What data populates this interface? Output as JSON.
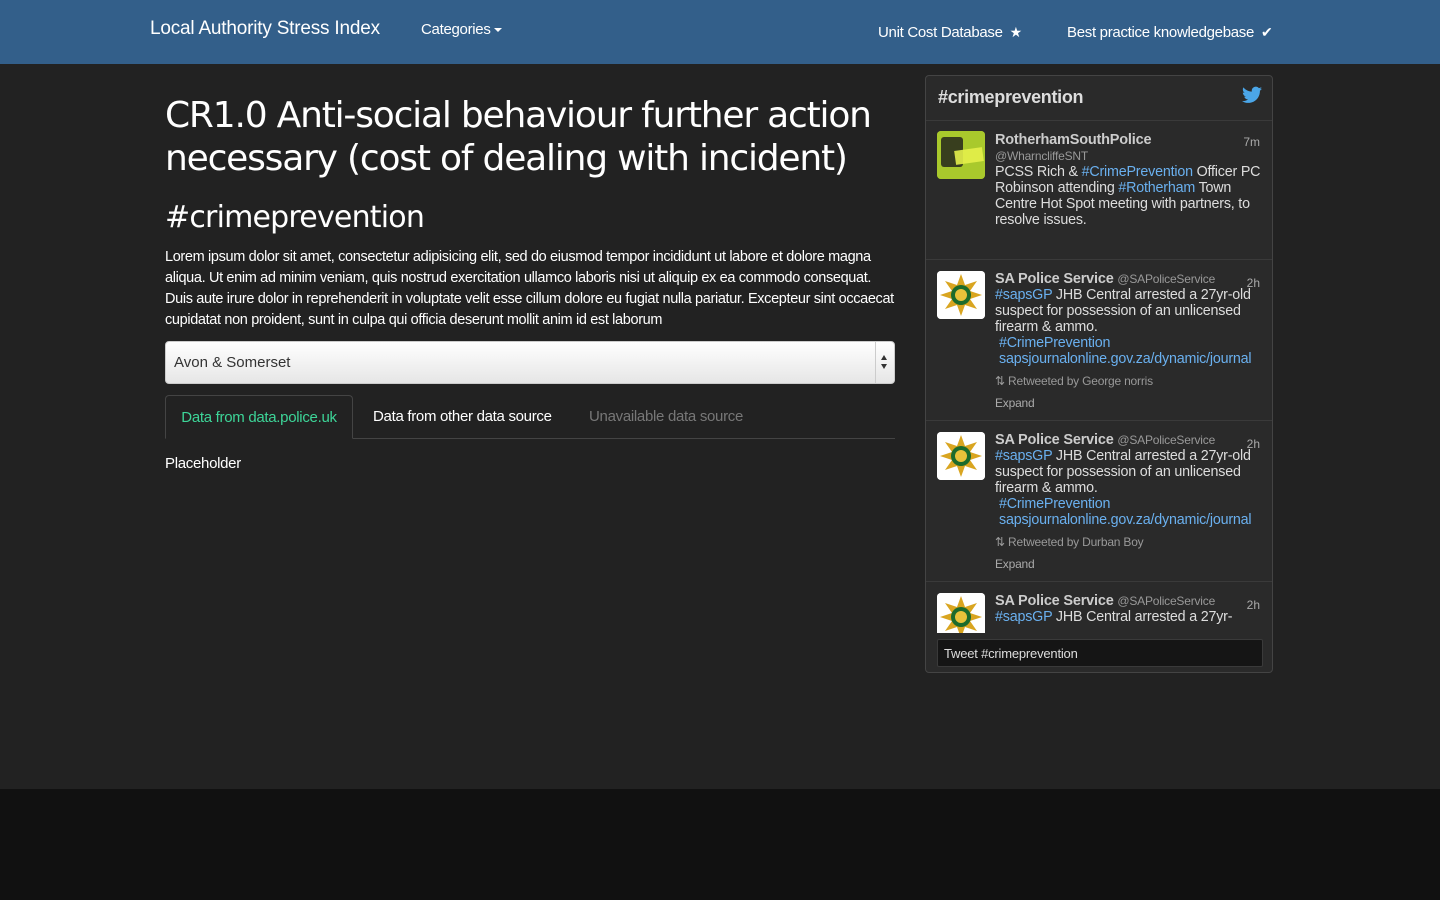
{
  "navbar": {
    "brand": "Local Authority Stress Index",
    "categories_label": "Categories",
    "unit_cost_label": "Unit Cost Database",
    "best_practice_label": "Best practice knowledgebase",
    "unit_cost_icon": "star-icon",
    "best_practice_icon": "checkmark-icon",
    "background": "#335f8a"
  },
  "main": {
    "title": "CR1.0 Anti-social behaviour further action necessary (cost of dealing with incident)",
    "subtitle": "#crimeprevention",
    "description": "Lorem ipsum dolor sit amet, consectetur adipisicing elit, sed do eiusmod tempor incididunt ut labore et dolore magna aliqua. Ut enim ad minim veniam, quis nostrud exercitation ullamco laboris nisi ut aliquip ex ea commodo consequat. Duis aute irure dolor in reprehenderit in voluptate velit esse cillum dolore eu fugiat nulla pariatur. Excepteur sint occaecat cupidatat non proident, sunt in culpa qui officia deserunt mollit anim id est laborum",
    "region_select": {
      "selected": "Avon & Somerset"
    },
    "tabs": [
      {
        "label": "Data from data.police.uk",
        "state": "active"
      },
      {
        "label": "Data from other data source",
        "state": "normal"
      },
      {
        "label": "Unavailable data source",
        "state": "disabled"
      }
    ],
    "placeholder": "Placeholder"
  },
  "twitter": {
    "title": "#crimeprevention",
    "bird_icon": "twitter-bird-icon",
    "tweets": [
      {
        "name": "RotherhamSouthPolice",
        "handle": "@WharncliffeSNT",
        "time": "7m",
        "text_1": "PCSS Rich & ",
        "tag_1": "#CrimePrevention",
        "text_2": " Officer PC Robinson attending ",
        "tag_2": "#Rotherham",
        "text_3": " Town Centre Hot Spot meeting with partners, to resolve issues."
      },
      {
        "name": "SA Police Service",
        "handle": "@SAPoliceService",
        "time": "2h",
        "tag_1": "#sapsGP",
        "text_1": " JHB Central arrested a 27yr-old suspect for possession of an unlicensed firearm & ammo.",
        "tag_2": "#CrimePrevention",
        "link": "sapsjournalonline.gov.za/dynamic/journal",
        "retweeted": "Retweeted by George norris",
        "expand": "Expand"
      },
      {
        "name": "SA Police Service",
        "handle": "@SAPoliceService",
        "time": "2h",
        "tag_1": "#sapsGP",
        "text_1": " JHB Central arrested a 27yr-old suspect for possession of an unlicensed firearm & ammo.",
        "tag_2": "#CrimePrevention",
        "link": "sapsjournalonline.gov.za/dynamic/journal",
        "retweeted": "Retweeted by Durban Boy",
        "expand": "Expand"
      },
      {
        "name": "SA Police Service",
        "handle": "@SAPoliceService",
        "time": "2h",
        "tag_1": "#sapsGP",
        "text_1": " JHB Central arrested a 27yr-"
      }
    ],
    "compose_label": "Tweet #crimeprevention"
  }
}
